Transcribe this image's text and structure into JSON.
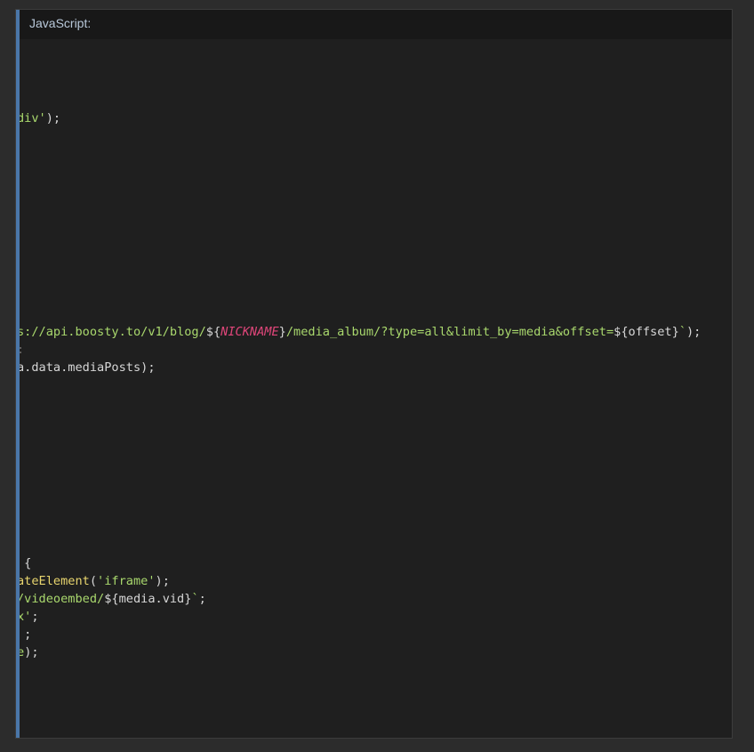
{
  "header": {
    "language_label": "JavaScript:"
  },
  "code_lines": {
    "l1": {
      "a": "div'",
      "b": ");"
    },
    "l2": {
      "a": "s://api.boosty.to/v1/blog/",
      "b": "${",
      "c": "NICKNAME",
      "d": "}",
      "e": "/media_album/?type=all&limit_by=media&offset=",
      "f": "${offset}",
      "g": "`",
      "h": ");"
    },
    "l3": {
      "a": ":"
    },
    "l4": {
      "a": "a.data.mediaPosts);"
    },
    "l5": {
      "a": " {"
    },
    "l6": {
      "a": "ateElement",
      "b": "(",
      "c": "'iframe'",
      "d": ");"
    },
    "l7": {
      "a": "/videoembed/",
      "b": "${media.vid}",
      "c": "`",
      "d": ";"
    },
    "l8": {
      "a": "x'",
      "b": ";"
    },
    "l9": {
      "a": " ;"
    },
    "l10": {
      "a": "e",
      "b": ");"
    }
  },
  "colors": {
    "accent_bar": "#4a76a8",
    "string": "#a9d86d",
    "keyword_italic": "#e0467a",
    "function": "#e8d56e"
  }
}
